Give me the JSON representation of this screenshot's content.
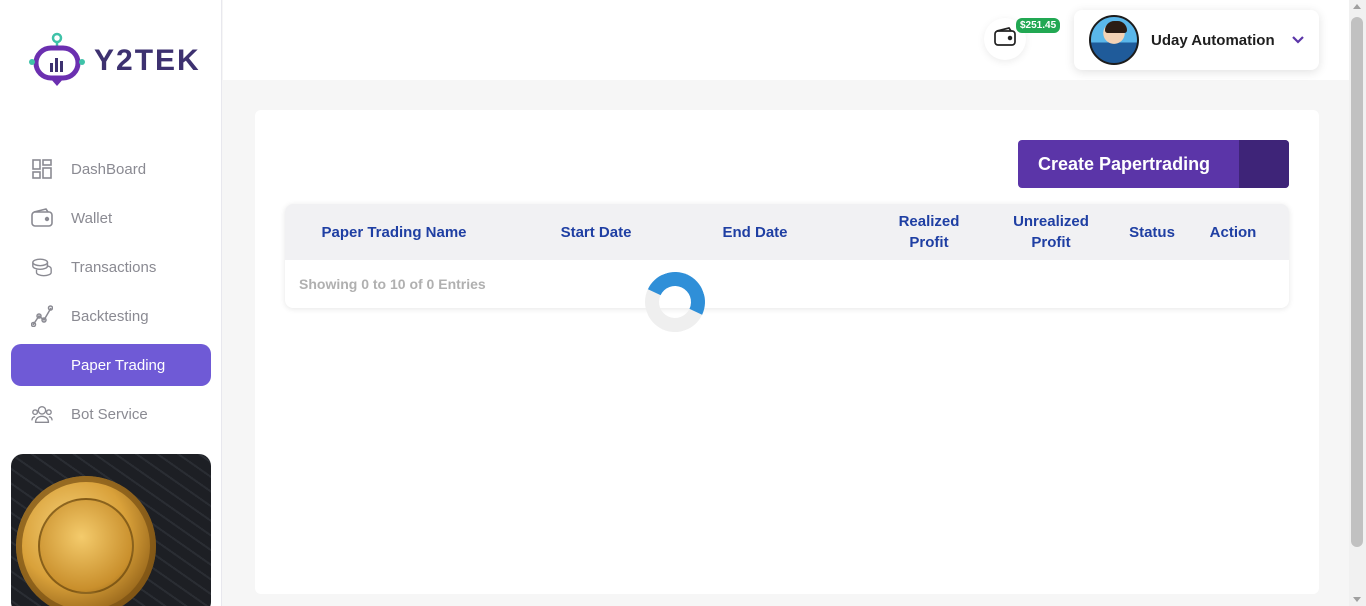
{
  "app": {
    "logo_text": "Y2TEK"
  },
  "sidebar": {
    "items": [
      {
        "label": "DashBoard",
        "icon": "dashboard-icon"
      },
      {
        "label": "Wallet",
        "icon": "wallet-icon"
      },
      {
        "label": "Transactions",
        "icon": "coins-icon"
      },
      {
        "label": "Backtesting",
        "icon": "chart-line-icon"
      },
      {
        "label": "Paper Trading",
        "icon": "paper-trading-icon",
        "active": true
      },
      {
        "label": "Bot Service",
        "icon": "users-icon"
      }
    ],
    "promo_image": "dogecoin-image"
  },
  "header": {
    "wallet_balance": "$251.45",
    "user_name": "Uday Automation"
  },
  "main": {
    "create_button_label": "Create Papertrading",
    "table": {
      "columns": [
        "Paper Trading Name",
        "Start Date",
        "End Date",
        "Realized Profit",
        "Unrealized Profit",
        "Status",
        "Action"
      ],
      "rows": [],
      "info": "Showing 0 to 10 of 0 Entries"
    },
    "loading": true
  },
  "colors": {
    "accent": "#6f5ad6",
    "button": "#5b35a8",
    "header_text": "#1f3fa3",
    "badge": "#22a853",
    "spinner": "#2f8fd8"
  }
}
